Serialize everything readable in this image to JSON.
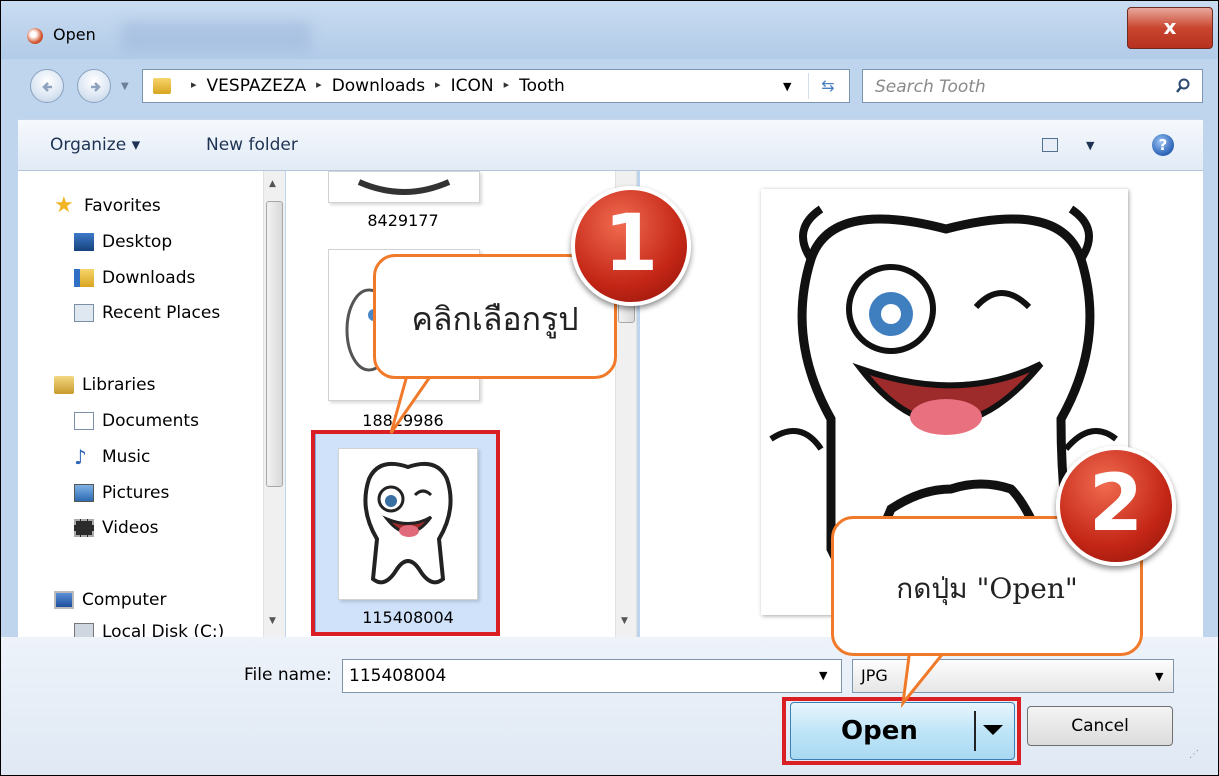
{
  "window": {
    "title": "Open",
    "close_glyph": "x"
  },
  "address": {
    "segments": [
      "VESPAZEZA",
      "Downloads",
      "ICON",
      "Tooth"
    ],
    "separator": "▸"
  },
  "search": {
    "placeholder": "Search Tooth"
  },
  "toolbar": {
    "organize": "Organize ▾",
    "new_folder": "New folder",
    "help": "?"
  },
  "nav": {
    "favorites": "Favorites",
    "desktop": "Desktop",
    "downloads": "Downloads",
    "recent": "Recent Places",
    "libraries": "Libraries",
    "documents": "Documents",
    "music": "Music",
    "pictures": "Pictures",
    "videos": "Videos",
    "computer": "Computer",
    "local_disk": "Local Disk (C:)"
  },
  "files": [
    {
      "name": "8429177"
    },
    {
      "name": "18829986"
    },
    {
      "name": "115408004"
    }
  ],
  "footer": {
    "file_name_label": "File name:",
    "file_name_value": "115408004",
    "filter": "JPG",
    "open": "Open",
    "cancel": "Cancel"
  },
  "annotations": {
    "step1_number": "1",
    "step1_text": "คลิกเลือกรูป",
    "step2_number": "2",
    "step2_text": "กดปุ่ม \"Open\""
  },
  "colors": {
    "highlight_box": "#d91e24",
    "callout_border": "#f07a2a",
    "badge": "#c42616",
    "selection": "#cfe2fa"
  }
}
